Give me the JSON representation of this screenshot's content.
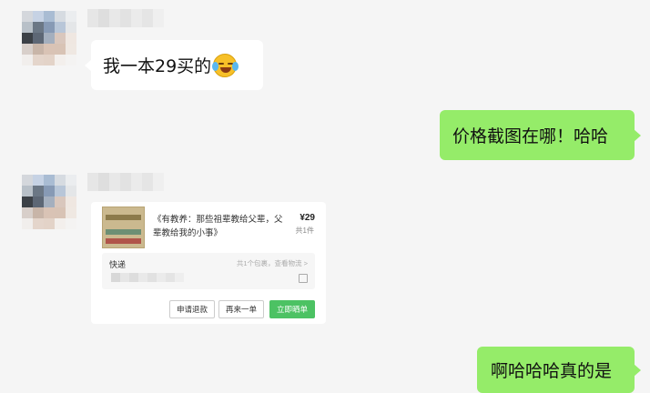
{
  "messages": [
    {
      "side": "left",
      "text": "我一本29买的",
      "emoji": "laughing-crying-emoji"
    },
    {
      "side": "right",
      "text": "价格截图在哪！哈哈"
    },
    {
      "side": "left",
      "type": "order-card"
    },
    {
      "side": "right",
      "text": "啊哈哈哈真的是"
    }
  ],
  "order_card": {
    "book_title": "《有教养：那些祖辈教给父辈，父辈教给我的小事》",
    "price": "¥29",
    "quantity": "共1件",
    "shipping_label": "快递",
    "shipping_info": "共1个包裹，查看物流 >",
    "buttons": {
      "refund": "申请退款",
      "rebuy": "再来一单",
      "review": "立即晒单"
    },
    "colors": {
      "primary_button": "#4cc263"
    }
  },
  "colors": {
    "background": "#f5f5f5",
    "received_bubble": "#ffffff",
    "sent_bubble": "#95ec69"
  }
}
